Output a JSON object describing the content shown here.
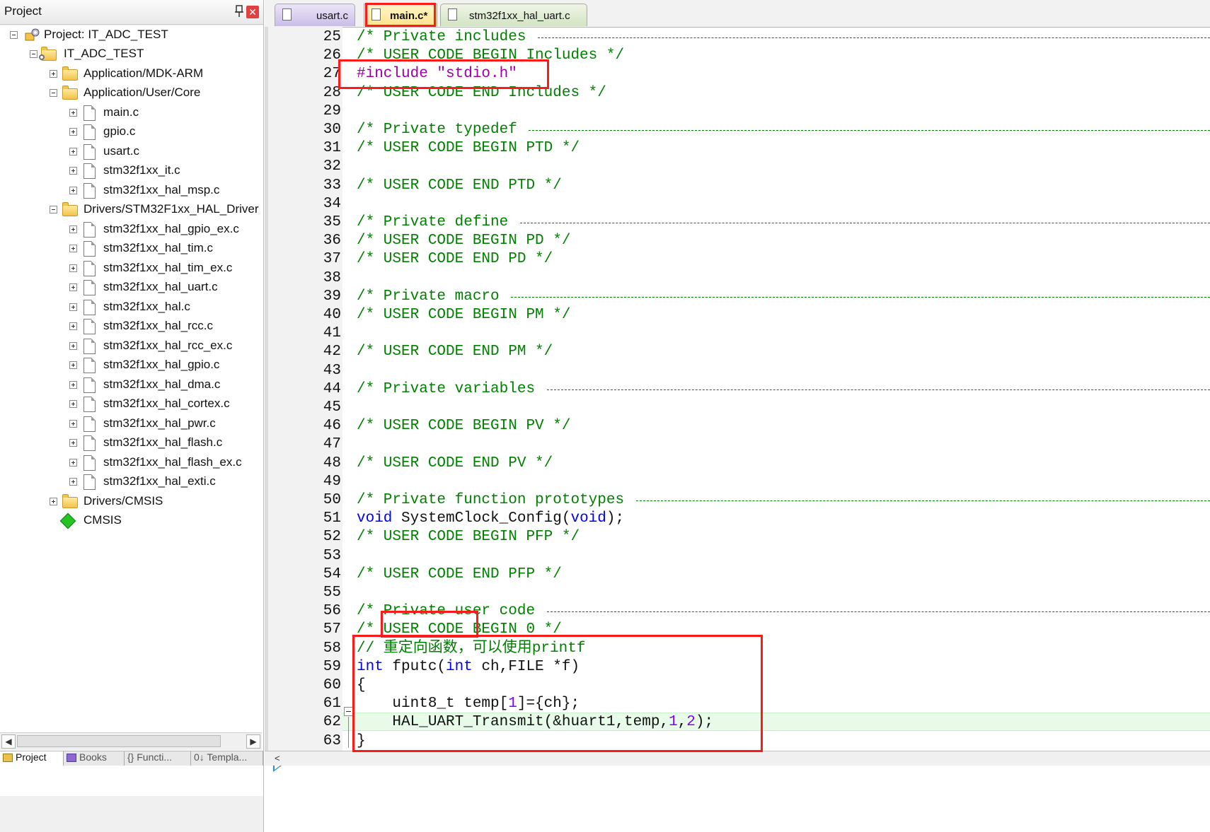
{
  "project_panel": {
    "title": "Project",
    "close_glyph": "✕",
    "tree": [
      {
        "label": "Project: IT_ADC_TEST",
        "icon": "project-icon",
        "expander": "minus"
      },
      {
        "label": "IT_ADC_TEST",
        "icon": "target-folder-icon",
        "expander": "minus"
      },
      {
        "label": "Application/MDK-ARM",
        "icon": "folder-icon",
        "expander": "plus"
      },
      {
        "label": "Application/User/Core",
        "icon": "folder-open-icon",
        "expander": "minus"
      },
      {
        "label": "main.c",
        "icon": "file-icon",
        "expander": "plus"
      },
      {
        "label": "gpio.c",
        "icon": "file-icon",
        "expander": "plus"
      },
      {
        "label": "usart.c",
        "icon": "file-icon",
        "expander": "plus"
      },
      {
        "label": "stm32f1xx_it.c",
        "icon": "file-icon",
        "expander": "plus"
      },
      {
        "label": "stm32f1xx_hal_msp.c",
        "icon": "file-icon",
        "expander": "plus"
      },
      {
        "label": "Drivers/STM32F1xx_HAL_Driver",
        "icon": "folder-open-icon",
        "expander": "minus"
      },
      {
        "label": "stm32f1xx_hal_gpio_ex.c",
        "icon": "file-icon",
        "expander": "plus"
      },
      {
        "label": "stm32f1xx_hal_tim.c",
        "icon": "file-icon",
        "expander": "plus"
      },
      {
        "label": "stm32f1xx_hal_tim_ex.c",
        "icon": "file-icon",
        "expander": "plus"
      },
      {
        "label": "stm32f1xx_hal_uart.c",
        "icon": "file-icon",
        "expander": "plus"
      },
      {
        "label": "stm32f1xx_hal.c",
        "icon": "file-icon",
        "expander": "plus"
      },
      {
        "label": "stm32f1xx_hal_rcc.c",
        "icon": "file-icon",
        "expander": "plus"
      },
      {
        "label": "stm32f1xx_hal_rcc_ex.c",
        "icon": "file-icon",
        "expander": "plus"
      },
      {
        "label": "stm32f1xx_hal_gpio.c",
        "icon": "file-icon",
        "expander": "plus"
      },
      {
        "label": "stm32f1xx_hal_dma.c",
        "icon": "file-icon",
        "expander": "plus"
      },
      {
        "label": "stm32f1xx_hal_cortex.c",
        "icon": "file-icon",
        "expander": "plus"
      },
      {
        "label": "stm32f1xx_hal_pwr.c",
        "icon": "file-icon",
        "expander": "plus"
      },
      {
        "label": "stm32f1xx_hal_flash.c",
        "icon": "file-icon",
        "expander": "plus"
      },
      {
        "label": "stm32f1xx_hal_flash_ex.c",
        "icon": "file-icon",
        "expander": "plus"
      },
      {
        "label": "stm32f1xx_hal_exti.c",
        "icon": "file-icon",
        "expander": "plus"
      },
      {
        "label": "Drivers/CMSIS",
        "icon": "folder-icon",
        "expander": "plus"
      },
      {
        "label": "CMSIS",
        "icon": "gem-icon",
        "expander": "none"
      }
    ],
    "bottom_tabs": [
      "Project",
      "Books",
      "{} Functi...",
      "0↓ Templa..."
    ]
  },
  "editor": {
    "tabs": [
      {
        "label": "usart.c",
        "active": false
      },
      {
        "label": "main.c*",
        "active": true
      },
      {
        "label": "stm32f1xx_hal_uart.c",
        "active": false
      }
    ],
    "lines": [
      {
        "n": "25",
        "html": "<span class=\"cm\">/* Private includes </span>",
        "dash": true
      },
      {
        "n": "26",
        "html": "<span class=\"cm\">/* USER CODE BEGIN Includes */</span>"
      },
      {
        "n": "27",
        "html": "<span class=\"pp\">#include </span><span class=\"st\">\"stdio.h\"</span>"
      },
      {
        "n": "28",
        "html": "<span class=\"cm\">/* USER CODE END Includes */</span>"
      },
      {
        "n": "29",
        "html": ""
      },
      {
        "n": "30",
        "html": "<span class=\"cm\">/* Private typedef </span>",
        "dash": true
      },
      {
        "n": "31",
        "html": "<span class=\"cm\">/* USER CODE BEGIN PTD */</span>"
      },
      {
        "n": "32",
        "html": ""
      },
      {
        "n": "33",
        "html": "<span class=\"cm\">/* USER CODE END PTD */</span>"
      },
      {
        "n": "34",
        "html": ""
      },
      {
        "n": "35",
        "html": "<span class=\"cm\">/* Private define </span>",
        "dash": true
      },
      {
        "n": "36",
        "html": "<span class=\"cm\">/* USER CODE BEGIN PD */</span>"
      },
      {
        "n": "37",
        "html": "<span class=\"cm\">/* USER CODE END PD */</span>"
      },
      {
        "n": "38",
        "html": ""
      },
      {
        "n": "39",
        "html": "<span class=\"cm\">/* Private macro </span>",
        "dash": true
      },
      {
        "n": "40",
        "html": "<span class=\"cm\">/* USER CODE BEGIN PM */</span>"
      },
      {
        "n": "41",
        "html": ""
      },
      {
        "n": "42",
        "html": "<span class=\"cm\">/* USER CODE END PM */</span>"
      },
      {
        "n": "43",
        "html": ""
      },
      {
        "n": "44",
        "html": "<span class=\"cm\">/* Private variables </span>",
        "dash": true
      },
      {
        "n": "45",
        "html": ""
      },
      {
        "n": "46",
        "html": "<span class=\"cm\">/* USER CODE BEGIN PV */</span>"
      },
      {
        "n": "47",
        "html": ""
      },
      {
        "n": "48",
        "html": "<span class=\"cm\">/* USER CODE END PV */</span>"
      },
      {
        "n": "49",
        "html": ""
      },
      {
        "n": "50",
        "html": "<span class=\"cm\">/* Private function prototypes </span>",
        "dash": true
      },
      {
        "n": "51",
        "html": "<span class=\"kw\">void</span> SystemClock_Config(<span class=\"kw\">void</span>);"
      },
      {
        "n": "52",
        "html": "<span class=\"cm\">/* USER CODE BEGIN PFP */</span>"
      },
      {
        "n": "53",
        "html": ""
      },
      {
        "n": "54",
        "html": "<span class=\"cm\">/* USER CODE END PFP */</span>"
      },
      {
        "n": "55",
        "html": ""
      },
      {
        "n": "56",
        "html": "<span class=\"cm\">/* Private user code </span>",
        "dash": true
      },
      {
        "n": "57",
        "html": "<span class=\"cm\">/* USER CODE BEGIN 0 */</span>"
      },
      {
        "n": "58",
        "html": "<span class=\"cm\">// 重定向函数，可以使用printf</span>"
      },
      {
        "n": "59",
        "html": "<span class=\"kw\">int</span> fputc(<span class=\"kw\">int</span> ch,FILE *f)"
      },
      {
        "n": "60",
        "html": "{"
      },
      {
        "n": "61",
        "html": "    uint8_t temp[<span class=\"nm\">1</span>]={ch};"
      },
      {
        "n": "62",
        "html": "    HAL_UART_Transmit(&amp;huart1,temp,<span class=\"nm\">1</span>,<span class=\"nm\">2</span>);"
      },
      {
        "n": "63",
        "html": "}"
      }
    ]
  },
  "colors": {
    "comment": "#008000",
    "keyword": "#0000ff",
    "string": "#a000a0",
    "number": "#7f00ff",
    "annotation": "#ff1a1a"
  }
}
